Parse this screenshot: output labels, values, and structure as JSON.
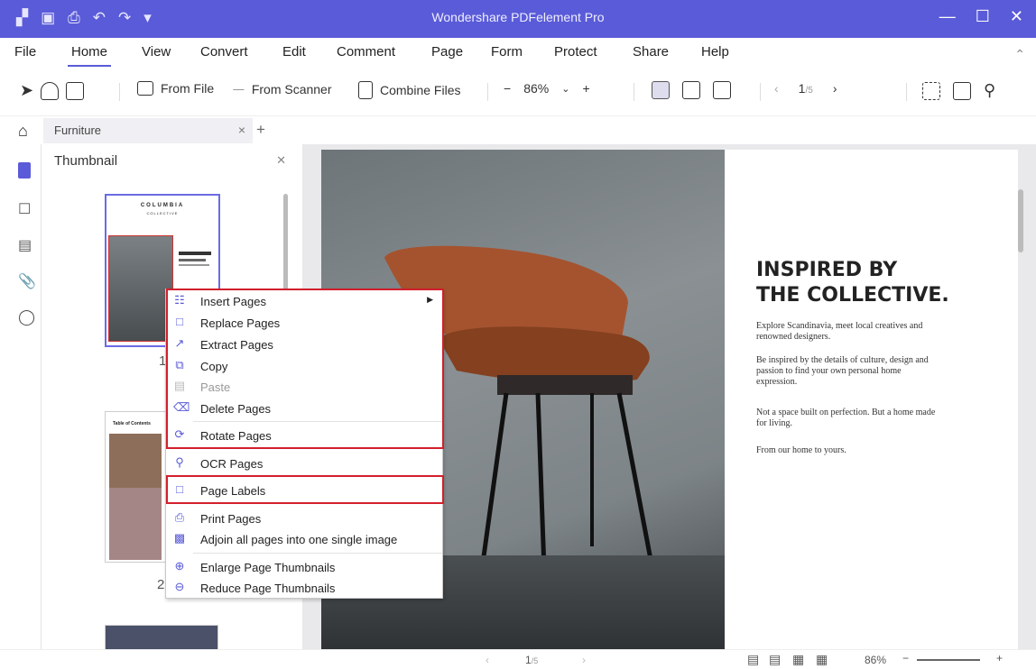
{
  "app": {
    "title": "Wondershare PDFelement Pro"
  },
  "colors": {
    "accent": "#5A5BD8",
    "highlight_border": "#D21F2C"
  },
  "menubar": {
    "items": [
      "File",
      "Home",
      "View",
      "Convert",
      "Edit",
      "Comment",
      "Page",
      "Form",
      "Protect",
      "Share",
      "Help"
    ],
    "active": "Home"
  },
  "toolbar": {
    "from_file": "From File",
    "from_scanner": "From Scanner",
    "combine_files": "Combine Files",
    "zoom": "86%",
    "page_current": "1",
    "page_total": "/5"
  },
  "tabs": {
    "document": "Furniture"
  },
  "thumbnail_panel": {
    "title": "Thumbnail",
    "page_numbers": [
      "1",
      "2"
    ]
  },
  "thumbnails": {
    "page1_brand": "COLUMBIA",
    "page1_sub": "COLLECTIVE",
    "page2_title": "Table of Contents"
  },
  "context_menu": {
    "items": [
      {
        "label": "Insert Pages",
        "icon": "insert-pages-icon",
        "submenu": true,
        "enabled": true
      },
      {
        "label": "Replace Pages",
        "icon": "replace-pages-icon",
        "enabled": true
      },
      {
        "label": "Extract Pages",
        "icon": "extract-pages-icon",
        "enabled": true
      },
      {
        "label": "Copy",
        "icon": "copy-icon",
        "enabled": true
      },
      {
        "label": "Paste",
        "icon": "paste-icon",
        "enabled": false
      },
      {
        "label": "Delete Pages",
        "icon": "delete-icon",
        "enabled": true
      },
      {
        "label": "Rotate Pages",
        "icon": "rotate-icon",
        "enabled": true
      },
      {
        "label": "OCR Pages",
        "icon": "ocr-icon",
        "enabled": true
      },
      {
        "label": "Page Labels",
        "icon": "page-labels-icon",
        "enabled": true
      },
      {
        "label": "Print Pages",
        "icon": "print-icon",
        "enabled": true
      },
      {
        "label": "Adjoin all pages into one single image",
        "icon": "adjoin-icon",
        "enabled": true
      },
      {
        "label": "Enlarge Page Thumbnails",
        "icon": "zoom-in-icon",
        "enabled": true
      },
      {
        "label": "Reduce Page Thumbnails",
        "icon": "zoom-out-icon",
        "enabled": true
      }
    ]
  },
  "document": {
    "heading_line1": "INSPIRED BY",
    "heading_line2": "THE COLLECTIVE.",
    "para1": "Explore Scandinavia, meet local creatives and renowned designers.",
    "para2": "Be inspired by the details of culture, design and passion to find your own personal home expression.",
    "para3": "Not a space built on perfection. But a home made for living.",
    "para4": "From our home to yours."
  },
  "statusbar": {
    "page_current": "1",
    "page_total": "/5",
    "zoom": "86%"
  }
}
